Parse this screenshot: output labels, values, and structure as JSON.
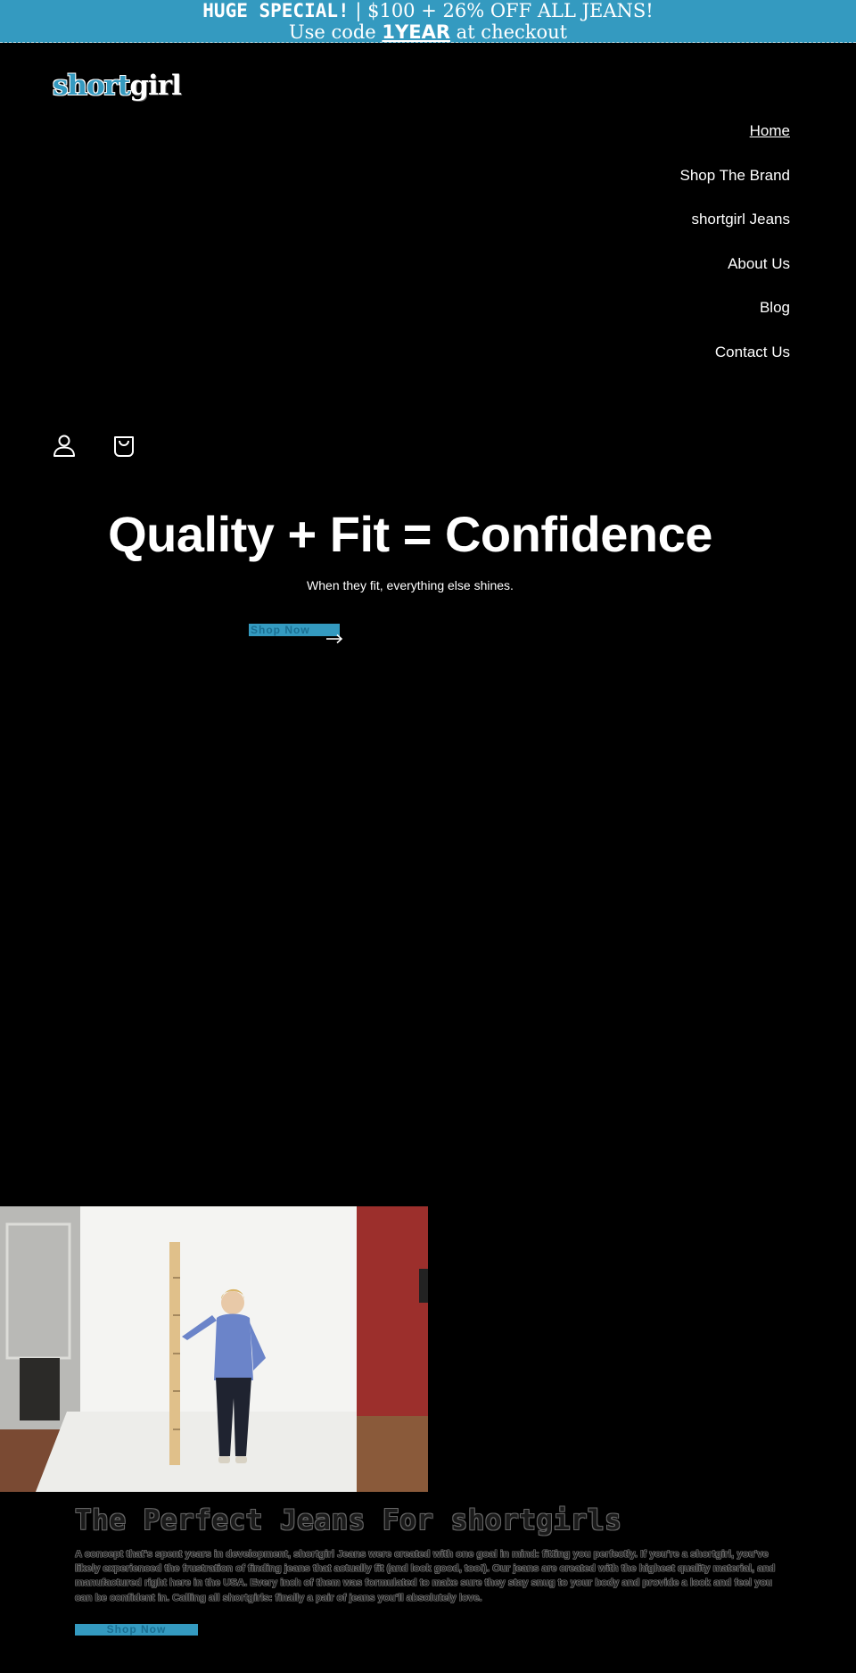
{
  "announcement": {
    "line1_strong": "HUGE SPECIAL!",
    "line1_sep": " | ",
    "line1_rest": "$100 + 26% OFF ALL JEANS!",
    "line2_pre": "Use code ",
    "line2_code": "1YEAR",
    "line2_post": " at checkout",
    "bg_color": "#349ac0"
  },
  "logo": {
    "part1": "short",
    "part2": "girl"
  },
  "nav": {
    "items": [
      {
        "label": "Home",
        "active": true
      },
      {
        "label": "Shop The Brand"
      },
      {
        "label": "shortgirl Jeans"
      },
      {
        "label": "About Us"
      },
      {
        "label": "Blog"
      },
      {
        "label": "Contact Us"
      }
    ]
  },
  "icons": {
    "account": "account-icon",
    "cart": "cart-icon",
    "arrow": "arrow-right-icon"
  },
  "hero": {
    "title": "Quality + Fit = Confidence",
    "subtitle": "When they fit, everything else shines.",
    "button_label": "Shop Now"
  },
  "section": {
    "title": "The Perfect Jeans For shortgirls",
    "body": "A concept that's spent years in development, shortgirl Jeans were created with one goal in mind: fitting you perfectly. If you're a shortgirl, you've likely experienced the frustration of finding jeans that actually fit (and look good, too!). Our jeans are created with the highest quality material, and manufactured right here in the USA. Every inch of them was formulated to make sure they stay snug to your body and provide a look and feel you can be confident in. Calling all shortgirls: finally a pair of jeans you'll absolutely love.",
    "button_label": "Shop Now"
  },
  "colors": {
    "accent": "#349ac0",
    "background": "#000000"
  }
}
